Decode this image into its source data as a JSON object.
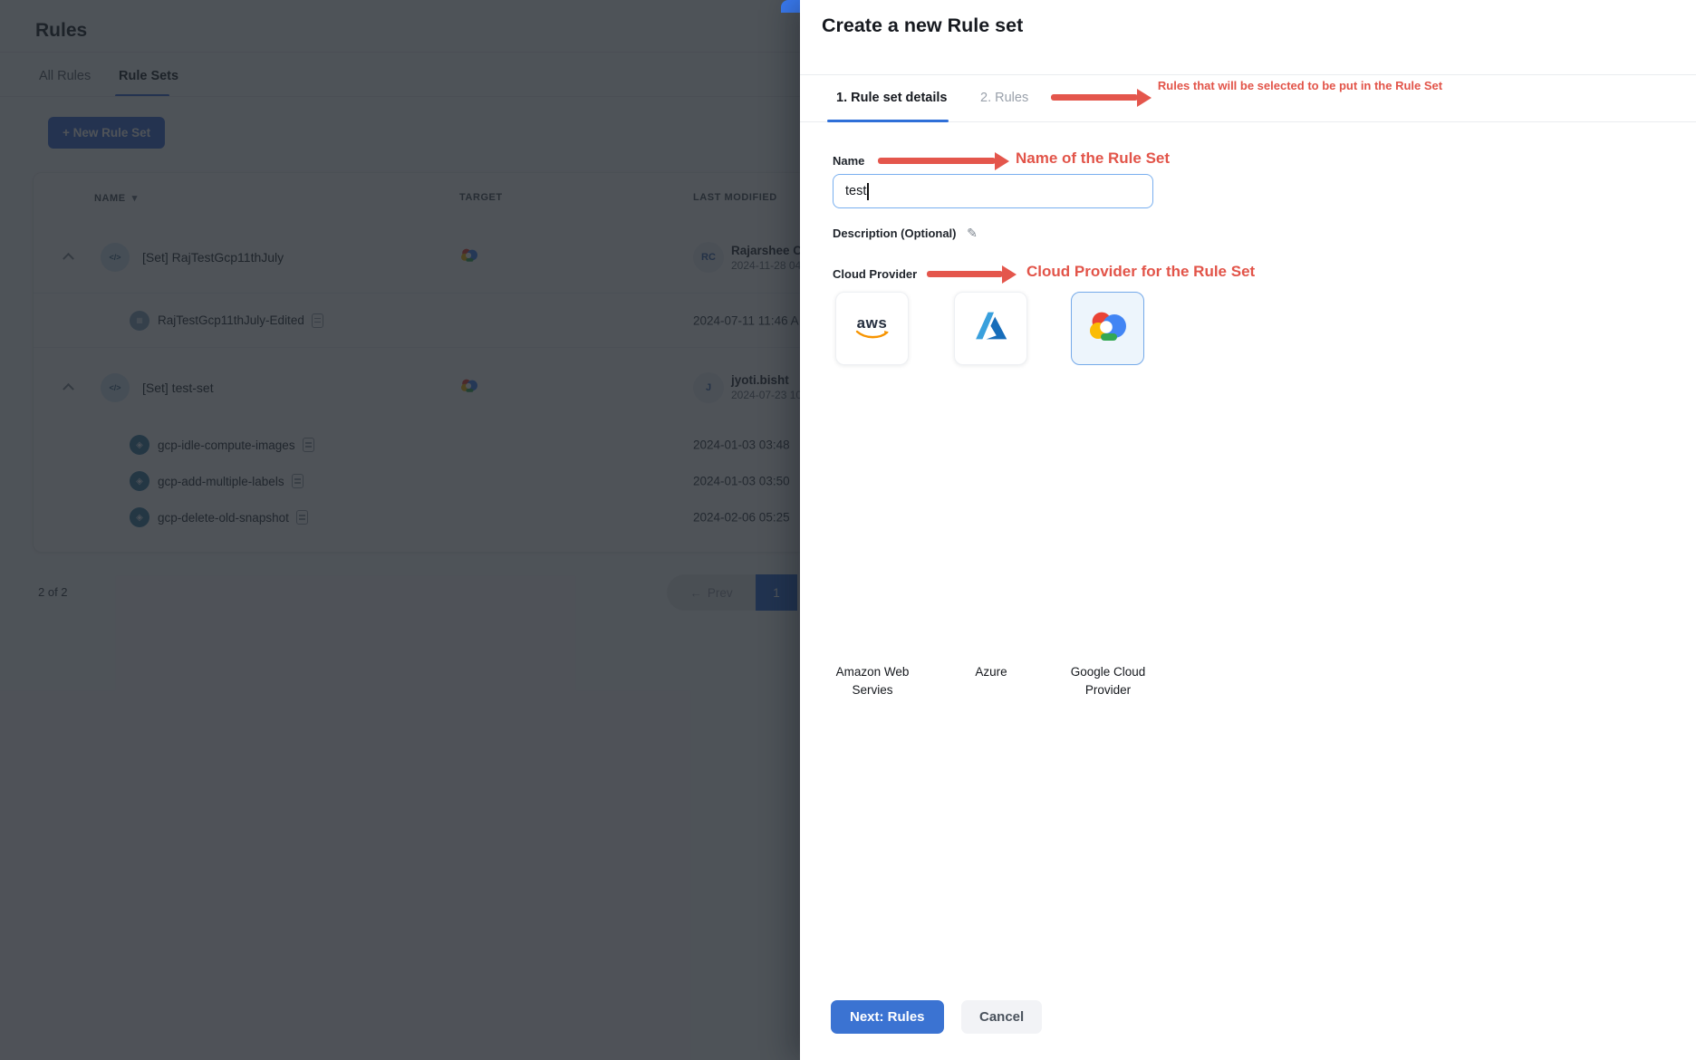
{
  "page": {
    "title": "Rules",
    "tabs": [
      {
        "label": "All Rules",
        "active": false
      },
      {
        "label": "Rule Sets",
        "active": true
      }
    ],
    "new_rule_set_button": "+ New Rule Set",
    "table": {
      "columns": [
        "NAME",
        "TARGET",
        "LAST MODIFIED"
      ],
      "rows": [
        {
          "type": "set",
          "name": "[Set] RajTestGcp11thJuly",
          "target": "gcp-cloud",
          "modified_by": "Rajarshee C",
          "initials": "RC",
          "date": "2024-11-28 04"
        },
        {
          "type": "rule",
          "name": "RajTestGcp11thJuly-Edited",
          "date": "2024-07-11 11:46 A"
        },
        {
          "type": "set",
          "name": "[Set] test-set",
          "target": "gcp-cloud",
          "modified_by": "jyoti.bisht",
          "initials": "J",
          "date": "2024-07-23 10"
        },
        {
          "type": "rule",
          "name": "gcp-idle-compute-images",
          "date": "2024-01-03 03:48"
        },
        {
          "type": "rule",
          "name": "gcp-add-multiple-labels",
          "date": "2024-01-03 03:50"
        },
        {
          "type": "rule",
          "name": "gcp-delete-old-snapshot",
          "date": "2024-02-06 05:25"
        }
      ],
      "pagination": {
        "summary": "2 of 2",
        "prev_label": "Prev",
        "prev_arrow": "←",
        "page": "1"
      }
    }
  },
  "drawer": {
    "title": "Create a new Rule set",
    "steps": [
      "1. Rule set details",
      "2. Rules"
    ],
    "name_label": "Name",
    "name_value": "test",
    "description_label": "Description (Optional)",
    "cloud_provider_label": "Cloud Provider",
    "providers": [
      {
        "id": "aws",
        "label": "Amazon Web Servies",
        "selected": false
      },
      {
        "id": "azure",
        "label": "Azure",
        "selected": false
      },
      {
        "id": "gcp",
        "label": "Google Cloud Provider",
        "selected": true
      }
    ],
    "next_button": "Next: Rules",
    "cancel_button": "Cancel"
  },
  "annotations": {
    "steps_note": "Rules that will be selected to be put in the Rule Set",
    "name_note": "Name of the Rule Set",
    "provider_note": "Cloud Provider for the Rule Set",
    "color": "#e25449"
  },
  "colors": {
    "accent_blue": "#3b73d2",
    "selected_card_border": "#74a9e9",
    "overlay": "rgba(30,34,41,0.78)"
  },
  "icons": {
    "set_glyph": "</>",
    "rule_glyph": "◈",
    "edited_glyph": "▦",
    "pencil": "✎"
  }
}
